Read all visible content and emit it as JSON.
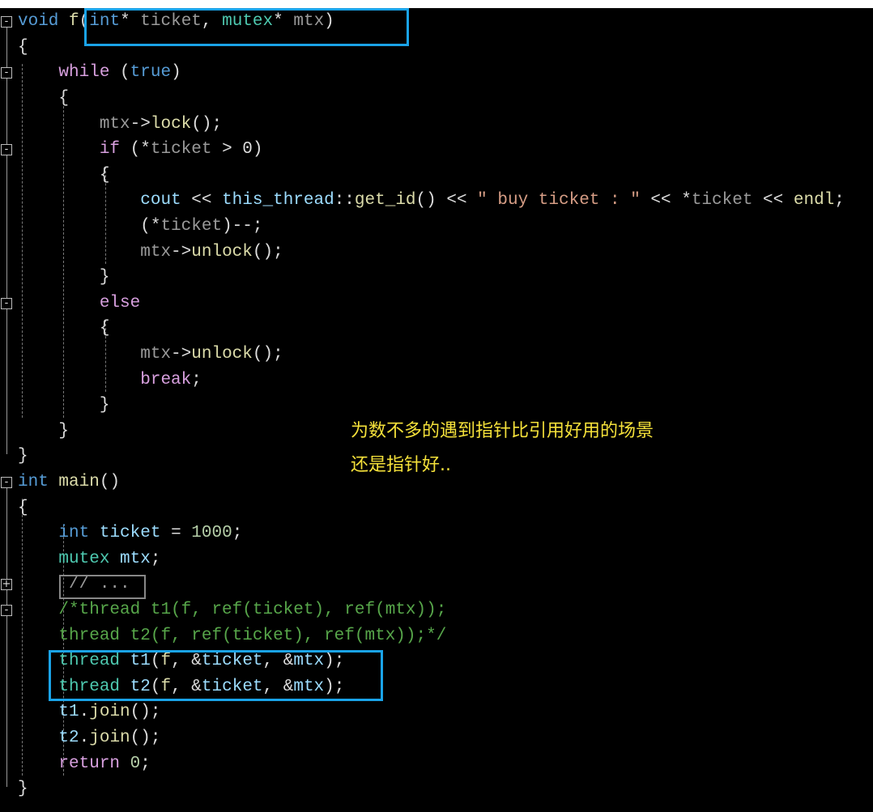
{
  "colors": {
    "kw": "#569cd6",
    "ctl": "#d8a0df",
    "type": "#4ec9b0",
    "var": "#9cdcfe",
    "param": "#9a9a9a",
    "fn": "#dcdcaa",
    "str": "#d69d85",
    "cmt": "#57a64a",
    "num": "#b5cea8",
    "txt": "#dcdcdc",
    "highlight": "#1aa3e8",
    "note": "#f5e13a"
  },
  "code": [
    [
      [
        "kw",
        "void"
      ],
      [
        "txt",
        " "
      ],
      [
        "fn",
        "f"
      ],
      [
        "txt",
        "("
      ],
      [
        "kw",
        "int"
      ],
      [
        "txt",
        "* "
      ],
      [
        "param",
        "ticket"
      ],
      [
        "txt",
        ", "
      ],
      [
        "type",
        "mutex"
      ],
      [
        "txt",
        "* "
      ],
      [
        "param",
        "mtx"
      ],
      [
        "txt",
        ")"
      ]
    ],
    [
      [
        "txt",
        "{"
      ]
    ],
    [
      [
        "txt",
        "    "
      ],
      [
        "ctl",
        "while"
      ],
      [
        "txt",
        " ("
      ],
      [
        "kw",
        "true"
      ],
      [
        "txt",
        ")"
      ]
    ],
    [
      [
        "txt",
        "    {"
      ]
    ],
    [
      [
        "txt",
        "        "
      ],
      [
        "param",
        "mtx"
      ],
      [
        "txt",
        "->"
      ],
      [
        "fn",
        "lock"
      ],
      [
        "txt",
        "();"
      ]
    ],
    [
      [
        "txt",
        "        "
      ],
      [
        "ctl",
        "if"
      ],
      [
        "txt",
        " (*"
      ],
      [
        "param",
        "ticket"
      ],
      [
        "txt",
        " > 0)"
      ]
    ],
    [
      [
        "txt",
        "        {"
      ]
    ],
    [
      [
        "txt",
        "            "
      ],
      [
        "var",
        "cout"
      ],
      [
        "txt",
        " << "
      ],
      [
        "var",
        "this_thread"
      ],
      [
        "txt",
        "::"
      ],
      [
        "fn",
        "get_id"
      ],
      [
        "txt",
        "() << "
      ],
      [
        "str",
        "\" buy ticket : \""
      ],
      [
        "txt",
        " << *"
      ],
      [
        "param",
        "ticket"
      ],
      [
        "txt",
        " << "
      ],
      [
        "fn",
        "endl"
      ],
      [
        "txt",
        ";"
      ]
    ],
    [
      [
        "txt",
        "            (*"
      ],
      [
        "param",
        "ticket"
      ],
      [
        "txt",
        ")--;"
      ]
    ],
    [
      [
        "txt",
        "            "
      ],
      [
        "param",
        "mtx"
      ],
      [
        "txt",
        "->"
      ],
      [
        "fn",
        "unlock"
      ],
      [
        "txt",
        "();"
      ]
    ],
    [
      [
        "txt",
        "        }"
      ]
    ],
    [
      [
        "txt",
        "        "
      ],
      [
        "ctl",
        "else"
      ]
    ],
    [
      [
        "txt",
        "        {"
      ]
    ],
    [
      [
        "txt",
        "            "
      ],
      [
        "param",
        "mtx"
      ],
      [
        "txt",
        "->"
      ],
      [
        "fn",
        "unlock"
      ],
      [
        "txt",
        "();"
      ]
    ],
    [
      [
        "txt",
        "            "
      ],
      [
        "ctl",
        "break"
      ],
      [
        "txt",
        ";"
      ]
    ],
    [
      [
        "txt",
        "        }"
      ]
    ],
    [
      [
        "txt",
        "    }"
      ]
    ],
    [
      [
        "txt",
        "}"
      ]
    ],
    [
      [
        "kw",
        "int"
      ],
      [
        "txt",
        " "
      ],
      [
        "fn",
        "main"
      ],
      [
        "txt",
        "()"
      ]
    ],
    [
      [
        "txt",
        "{"
      ]
    ],
    [
      [
        "txt",
        "    "
      ],
      [
        "kw",
        "int"
      ],
      [
        "txt",
        " "
      ],
      [
        "var",
        "ticket"
      ],
      [
        "txt",
        " = "
      ],
      [
        "num",
        "1000"
      ],
      [
        "txt",
        ";"
      ]
    ],
    [
      [
        "txt",
        "    "
      ],
      [
        "type",
        "mutex"
      ],
      [
        "txt",
        " "
      ],
      [
        "var",
        "mtx"
      ],
      [
        "txt",
        ";"
      ]
    ],
    [
      [
        "txt",
        "     "
      ],
      [
        "param",
        "// ..."
      ]
    ],
    [
      [
        "txt",
        "    "
      ],
      [
        "cmt",
        "/*thread t1(f, ref(ticket), ref(mtx));"
      ]
    ],
    [
      [
        "txt",
        "    "
      ],
      [
        "cmt",
        "thread t2(f, ref(ticket), ref(mtx));*/"
      ]
    ],
    [
      [
        "txt",
        "    "
      ],
      [
        "type",
        "thread"
      ],
      [
        "txt",
        " "
      ],
      [
        "var",
        "t1"
      ],
      [
        "txt",
        "("
      ],
      [
        "fn",
        "f"
      ],
      [
        "txt",
        ", &"
      ],
      [
        "var",
        "ticket"
      ],
      [
        "txt",
        ", &"
      ],
      [
        "var",
        "mtx"
      ],
      [
        "txt",
        ");"
      ]
    ],
    [
      [
        "txt",
        "    "
      ],
      [
        "type",
        "thread"
      ],
      [
        "txt",
        " "
      ],
      [
        "var",
        "t2"
      ],
      [
        "txt",
        "("
      ],
      [
        "fn",
        "f"
      ],
      [
        "txt",
        ", &"
      ],
      [
        "var",
        "ticket"
      ],
      [
        "txt",
        ", &"
      ],
      [
        "var",
        "mtx"
      ],
      [
        "txt",
        ");"
      ]
    ],
    [
      [
        "txt",
        "    "
      ],
      [
        "var",
        "t1"
      ],
      [
        "txt",
        "."
      ],
      [
        "fn",
        "join"
      ],
      [
        "txt",
        "();"
      ]
    ],
    [
      [
        "txt",
        "    "
      ],
      [
        "var",
        "t2"
      ],
      [
        "txt",
        "."
      ],
      [
        "fn",
        "join"
      ],
      [
        "txt",
        "();"
      ]
    ],
    [
      [
        "txt",
        "    "
      ],
      [
        "ctl",
        "return"
      ],
      [
        "txt",
        " "
      ],
      [
        "num",
        "0"
      ],
      [
        "txt",
        ";"
      ]
    ],
    [
      [
        "txt",
        "}"
      ]
    ]
  ],
  "fold_markers": [
    {
      "line": 0,
      "state": "-"
    },
    {
      "line": 2,
      "state": "-"
    },
    {
      "line": 5,
      "state": "-"
    },
    {
      "line": 11,
      "state": "-"
    },
    {
      "line": 18,
      "state": "-"
    },
    {
      "line": 22,
      "state": "+"
    },
    {
      "line": 23,
      "state": "-"
    }
  ],
  "annotation": {
    "line1": "为数不多的遇到指针比引用好用的场景",
    "line2": "还是指针好.."
  }
}
